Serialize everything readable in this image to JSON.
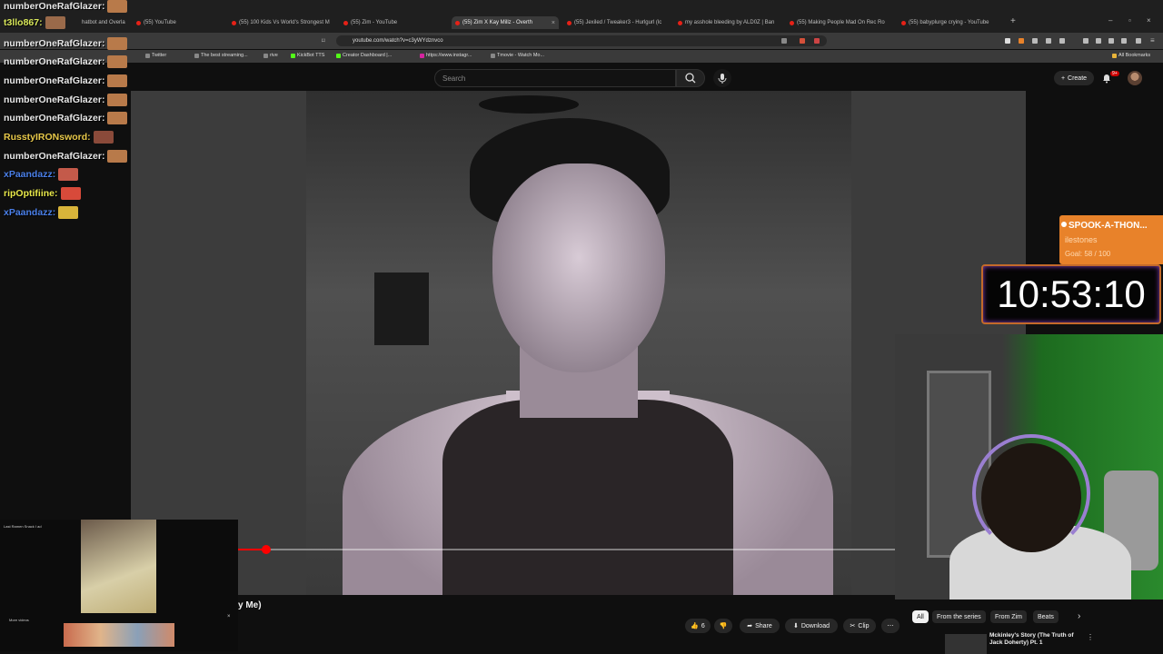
{
  "browser": {
    "tabs": [
      {
        "label": "(55) YouTube",
        "active": false
      },
      {
        "label": "(55) 100 Kids Vs World's Strongest M",
        "active": false
      },
      {
        "label": "(55) Zim - YouTube",
        "active": false
      },
      {
        "label": "(55) Zim X Kay Millz - Overth",
        "active": true
      },
      {
        "label": "(55) Jexiled / Tweaker3 - Hurlgurl (lc",
        "active": false
      },
      {
        "label": "my asshole bleeding by ALD0Z | Ban",
        "active": false
      },
      {
        "label": "(55) Making People Mad On Rec Ro",
        "active": false
      },
      {
        "label": "(55) babyplurge crying - YouTube",
        "active": false
      }
    ],
    "partial_tab": "hatbot and Overla",
    "url": "youtube.com/watch?v=c3yWYdznvco",
    "bookmarks": [
      "Twitter",
      "The best streaming...",
      "rive",
      "KickBot TTS",
      "Creator Dashboard |...",
      "https://www.instagr...",
      "Tmovie - Watch Mo..."
    ],
    "all_bookmarks": "All Bookmarks"
  },
  "youtube": {
    "search_placeholder": "Search",
    "create_label": "Create",
    "notif_badge": "9+",
    "video_title_partial": "y Me)",
    "progress_fraction": 0.045,
    "actions": {
      "like_count": "6",
      "share": "Share",
      "download": "Download",
      "clip": "Clip"
    },
    "chips": [
      "All",
      "From the series",
      "From Zim",
      "Beats"
    ],
    "rec_title": "Mckinley's Story (The Truth of Jack Doherty) Pt. 1"
  },
  "overlay": {
    "spook_title": "SPOOK-A-THON...",
    "spook_sub": "ilestones",
    "spook_goal": "Goal: 58 / 100",
    "timer": "10:53:10"
  },
  "chat": [
    {
      "user": "numberOneRafGlazer:",
      "color": "#e8e8e8",
      "emote": "#b87a4a"
    },
    {
      "user": "t3llo867:",
      "color": "#d9e85a",
      "emote": "#9a6a4a"
    },
    {
      "user": "numberOneRafGlazer:",
      "color": "#e8e8e8",
      "emote": "#b87a4a"
    },
    {
      "user": "numberOneRafGlazer:",
      "color": "#e8e8e8",
      "emote": "#b87a4a"
    },
    {
      "user": "numberOneRafGlazer:",
      "color": "#e8e8e8",
      "emote": "#b87a4a"
    },
    {
      "user": "numberOneRafGlazer:",
      "color": "#e8e8e8",
      "emote": "#b87a4a"
    },
    {
      "user": "numberOneRafGlazer:",
      "color": "#e8e8e8",
      "emote": "#b87a4a"
    },
    {
      "user": "RusstyIRONsword:",
      "color": "#e8c94a",
      "emote": "#8a4a3a"
    },
    {
      "user": "numberOneRafGlazer:",
      "color": "#e8e8e8",
      "emote": "#b87a4a"
    },
    {
      "user": "xPaandazz:",
      "color": "#4a7fe8",
      "emote": "#c45a4a"
    },
    {
      "user": "ripOptifiine:",
      "color": "#e8e84a",
      "emote": "#d84a3a"
    },
    {
      "user": "xPaandazz:",
      "color": "#4a7fe8",
      "emote": "#d8b43a"
    }
  ],
  "miniplayer": {
    "title": "Last Ramen Snack I ad",
    "more": "More videos"
  }
}
